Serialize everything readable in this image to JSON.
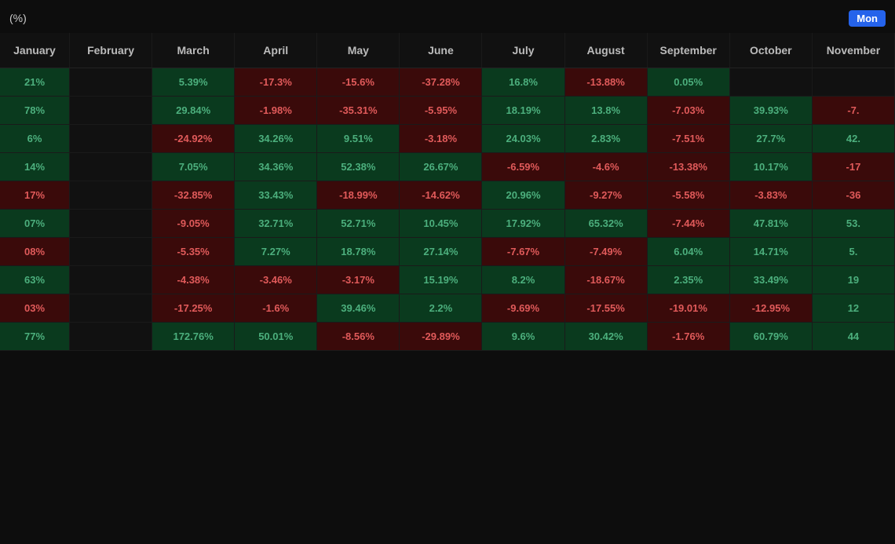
{
  "header": {
    "title": "(%)",
    "type_label": "Mon"
  },
  "columns": [
    "January",
    "February",
    "March",
    "April",
    "May",
    "June",
    "July",
    "August",
    "September",
    "October",
    "November"
  ],
  "rows": [
    {
      "cells": [
        {
          "v": "21%",
          "s": "pos"
        },
        {
          "v": "",
          "s": "empty"
        },
        {
          "v": "5.39%",
          "s": "pos"
        },
        {
          "v": "-17.3%",
          "s": "neg"
        },
        {
          "v": "-15.6%",
          "s": "neg"
        },
        {
          "v": "-37.28%",
          "s": "neg"
        },
        {
          "v": "16.8%",
          "s": "pos"
        },
        {
          "v": "-13.88%",
          "s": "neg"
        },
        {
          "v": "0.05%",
          "s": "pos"
        },
        {
          "v": "",
          "s": "empty"
        },
        {
          "v": "",
          "s": "empty"
        }
      ]
    },
    {
      "cells": [
        {
          "v": "78%",
          "s": "pos"
        },
        {
          "v": "",
          "s": "empty"
        },
        {
          "v": "29.84%",
          "s": "pos"
        },
        {
          "v": "-1.98%",
          "s": "neg"
        },
        {
          "v": "-35.31%",
          "s": "neg"
        },
        {
          "v": "-5.95%",
          "s": "neg"
        },
        {
          "v": "18.19%",
          "s": "pos"
        },
        {
          "v": "13.8%",
          "s": "pos"
        },
        {
          "v": "-7.03%",
          "s": "neg"
        },
        {
          "v": "39.93%",
          "s": "pos"
        },
        {
          "v": "-7.",
          "s": "neg"
        }
      ]
    },
    {
      "cells": [
        {
          "v": "6%",
          "s": "pos"
        },
        {
          "v": "",
          "s": "empty"
        },
        {
          "v": "-24.92%",
          "s": "neg"
        },
        {
          "v": "34.26%",
          "s": "pos"
        },
        {
          "v": "9.51%",
          "s": "pos"
        },
        {
          "v": "-3.18%",
          "s": "neg"
        },
        {
          "v": "24.03%",
          "s": "pos"
        },
        {
          "v": "2.83%",
          "s": "pos"
        },
        {
          "v": "-7.51%",
          "s": "neg"
        },
        {
          "v": "27.7%",
          "s": "pos"
        },
        {
          "v": "42.",
          "s": "pos"
        }
      ]
    },
    {
      "cells": [
        {
          "v": "14%",
          "s": "pos"
        },
        {
          "v": "",
          "s": "empty"
        },
        {
          "v": "7.05%",
          "s": "pos"
        },
        {
          "v": "34.36%",
          "s": "pos"
        },
        {
          "v": "52.38%",
          "s": "pos"
        },
        {
          "v": "26.67%",
          "s": "pos"
        },
        {
          "v": "-6.59%",
          "s": "neg"
        },
        {
          "v": "-4.6%",
          "s": "neg"
        },
        {
          "v": "-13.38%",
          "s": "neg"
        },
        {
          "v": "10.17%",
          "s": "pos"
        },
        {
          "v": "-17",
          "s": "neg"
        }
      ]
    },
    {
      "cells": [
        {
          "v": "17%",
          "s": "neg"
        },
        {
          "v": "",
          "s": "empty"
        },
        {
          "v": "-32.85%",
          "s": "neg"
        },
        {
          "v": "33.43%",
          "s": "pos"
        },
        {
          "v": "-18.99%",
          "s": "neg"
        },
        {
          "v": "-14.62%",
          "s": "neg"
        },
        {
          "v": "20.96%",
          "s": "pos"
        },
        {
          "v": "-9.27%",
          "s": "neg"
        },
        {
          "v": "-5.58%",
          "s": "neg"
        },
        {
          "v": "-3.83%",
          "s": "neg"
        },
        {
          "v": "-36",
          "s": "neg"
        }
      ]
    },
    {
      "cells": [
        {
          "v": "07%",
          "s": "pos"
        },
        {
          "v": "",
          "s": "empty"
        },
        {
          "v": "-9.05%",
          "s": "neg"
        },
        {
          "v": "32.71%",
          "s": "pos"
        },
        {
          "v": "52.71%",
          "s": "pos"
        },
        {
          "v": "10.45%",
          "s": "pos"
        },
        {
          "v": "17.92%",
          "s": "pos"
        },
        {
          "v": "65.32%",
          "s": "pos"
        },
        {
          "v": "-7.44%",
          "s": "neg"
        },
        {
          "v": "47.81%",
          "s": "pos"
        },
        {
          "v": "53.",
          "s": "pos"
        }
      ]
    },
    {
      "cells": [
        {
          "v": "08%",
          "s": "neg"
        },
        {
          "v": "",
          "s": "empty"
        },
        {
          "v": "-5.35%",
          "s": "neg"
        },
        {
          "v": "7.27%",
          "s": "pos"
        },
        {
          "v": "18.78%",
          "s": "pos"
        },
        {
          "v": "27.14%",
          "s": "pos"
        },
        {
          "v": "-7.67%",
          "s": "neg"
        },
        {
          "v": "-7.49%",
          "s": "neg"
        },
        {
          "v": "6.04%",
          "s": "pos"
        },
        {
          "v": "14.71%",
          "s": "pos"
        },
        {
          "v": "5.",
          "s": "pos"
        }
      ]
    },
    {
      "cells": [
        {
          "v": "63%",
          "s": "pos"
        },
        {
          "v": "",
          "s": "empty"
        },
        {
          "v": "-4.38%",
          "s": "neg"
        },
        {
          "v": "-3.46%",
          "s": "neg"
        },
        {
          "v": "-3.17%",
          "s": "neg"
        },
        {
          "v": "15.19%",
          "s": "pos"
        },
        {
          "v": "8.2%",
          "s": "pos"
        },
        {
          "v": "-18.67%",
          "s": "neg"
        },
        {
          "v": "2.35%",
          "s": "pos"
        },
        {
          "v": "33.49%",
          "s": "pos"
        },
        {
          "v": "19",
          "s": "pos"
        }
      ]
    },
    {
      "cells": [
        {
          "v": "03%",
          "s": "neg"
        },
        {
          "v": "",
          "s": "empty"
        },
        {
          "v": "-17.25%",
          "s": "neg"
        },
        {
          "v": "-1.6%",
          "s": "neg"
        },
        {
          "v": "39.46%",
          "s": "pos"
        },
        {
          "v": "2.2%",
          "s": "pos"
        },
        {
          "v": "-9.69%",
          "s": "neg"
        },
        {
          "v": "-17.55%",
          "s": "neg"
        },
        {
          "v": "-19.01%",
          "s": "neg"
        },
        {
          "v": "-12.95%",
          "s": "neg"
        },
        {
          "v": "12",
          "s": "pos"
        }
      ]
    },
    {
      "cells": [
        {
          "v": "77%",
          "s": "pos"
        },
        {
          "v": "",
          "s": "empty"
        },
        {
          "v": "172.76%",
          "s": "pos"
        },
        {
          "v": "50.01%",
          "s": "pos"
        },
        {
          "v": "-8.56%",
          "s": "neg"
        },
        {
          "v": "-29.89%",
          "s": "neg"
        },
        {
          "v": "9.6%",
          "s": "pos"
        },
        {
          "v": "30.42%",
          "s": "pos"
        },
        {
          "v": "-1.76%",
          "s": "neg"
        },
        {
          "v": "60.79%",
          "s": "pos"
        },
        {
          "v": "44",
          "s": "pos"
        }
      ]
    }
  ]
}
